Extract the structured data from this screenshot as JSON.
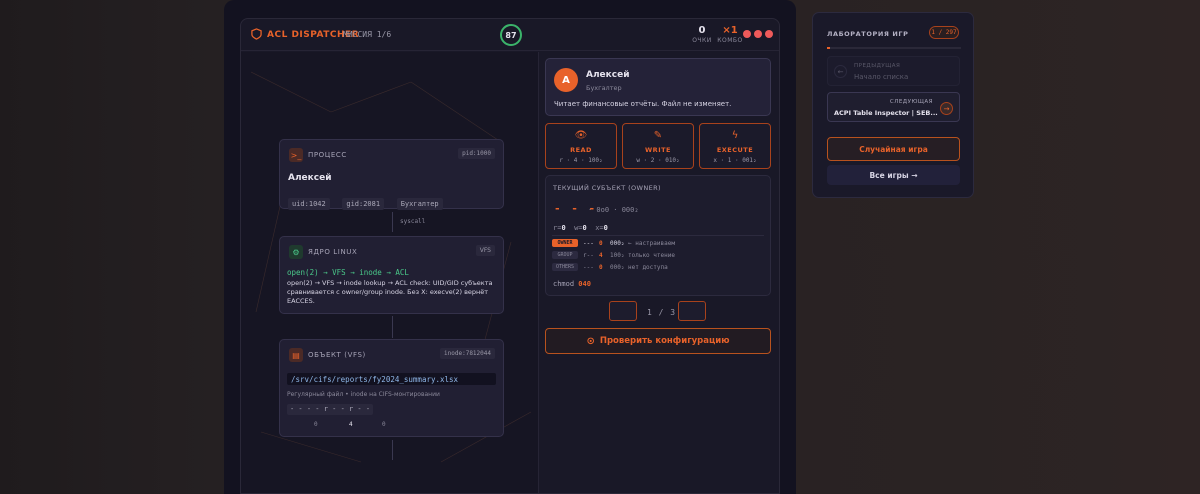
{
  "app": {
    "title": "ACL DISPATCHER",
    "mission": "МИССИЯ 1/6",
    "timer": "87",
    "score": "0",
    "score_label": "ОЧКИ",
    "combo": "×1",
    "combo_label": "КОМБО"
  },
  "process": {
    "title": "ПРОЦЕСС",
    "pid": "pid:1000",
    "name": "Алексей",
    "tags": [
      "uid:1042",
      "gid:2081",
      "Бухгалтер"
    ]
  },
  "syscall": "syscall",
  "kernel": {
    "title": "ЯДРО LINUX",
    "badge": "VFS",
    "flow": "open(2) → VFS → inode → ACL",
    "desc": "open(2) → VFS → inode lookup → ACL check: UID/GID субъекта сравнивается с owner/group inode. Без X: execve(2) вернёт EACCES."
  },
  "object": {
    "title": "ОБЪЕКТ (VFS)",
    "inode": "inode:7812044",
    "path": "/srv/cifs/reports/fy2024_summary.xlsx",
    "desc": "Регулярный файл • inode на CIFS-монтировании",
    "mode": "- - - - r - - r - -",
    "octal": [
      "0",
      "4",
      "0"
    ]
  },
  "user": {
    "initial": "А",
    "name": "Алексей",
    "role": "Бухгалтер",
    "desc": "Читает финансовые отчёты. Файл не изменяет."
  },
  "perms": [
    {
      "label": "READ",
      "bits": "r · 4 · 100₂"
    },
    {
      "label": "WRITE",
      "bits": "w · 2 · 010₂"
    },
    {
      "label": "EXECUTE",
      "bits": "x · 1 · 001₂"
    }
  ],
  "subject": {
    "title": "ТЕКУЩИЙ СУБЪЕКТ (OWNER)",
    "bits": "- - -",
    "octal": "· 0o0 · 000₂",
    "r_label": "r=",
    "r": "0",
    "w_label": "w=",
    "w": "0",
    "x_label": "x=",
    "x": "0",
    "rows": [
      {
        "label": "OWNER",
        "bits": "---",
        "num": "0",
        "octal": "000₂",
        "desc": "← настраиваем"
      },
      {
        "label": "GROUP",
        "bits": "r--",
        "num": "4",
        "octal": "100₂",
        "desc": "только чтение"
      },
      {
        "label": "OTHERS",
        "bits": "---",
        "num": "0",
        "octal": "000₂",
        "desc": "нет доступа"
      }
    ],
    "chmod_label": "chmod",
    "chmod": "040"
  },
  "pager": "1 / 3",
  "check_label": "Проверить конфигурацию",
  "lab": {
    "title": "ЛАБОРАТОРИЯ ИГР",
    "count": "1 / 297",
    "progress": 0.003,
    "prev_label": "ПРЕДЫДУЩАЯ",
    "prev_value": "Начало списка",
    "next_label": "СЛЕДУЮЩАЯ",
    "next_value": "ACPI Table Inspector | SEB...",
    "random": "Случайная игра",
    "all": "Все игры →"
  },
  "colors": {
    "accent": "#e8622a",
    "timer": "#3bb36a",
    "lives": "#ee5a5a"
  }
}
